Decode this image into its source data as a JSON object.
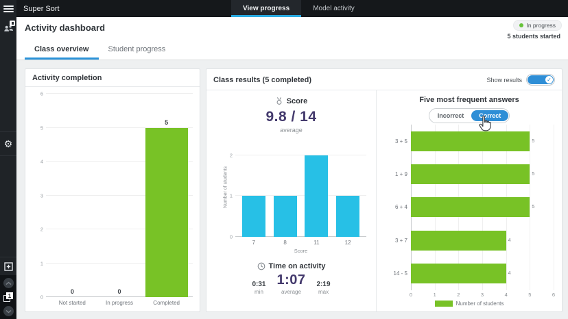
{
  "app": {
    "title": "Super Sort"
  },
  "topbar": {
    "tabs": [
      {
        "label": "View progress",
        "active": true
      },
      {
        "label": "Model activity",
        "active": false
      }
    ]
  },
  "header": {
    "title": "Activity dashboard",
    "status_badge": "In progress",
    "students_started": "5 students started"
  },
  "page_tabs": [
    {
      "label": "Class overview",
      "active": true
    },
    {
      "label": "Student progress",
      "active": false
    }
  ],
  "sidebar": {
    "page_indicator": "1"
  },
  "colors": {
    "green": "#78c226",
    "cyan": "#27c0e6",
    "blue": "#2e8ed6",
    "purple": "#443a6d",
    "status_green": "#67c23a",
    "tab_underline": "#29abe2"
  },
  "class_results": {
    "title": "Class results (5 completed)",
    "show_results_label": "Show results",
    "score": {
      "label": "Score",
      "value": "9.8 / 14",
      "caption": "average"
    },
    "time": {
      "label": "Time on activity",
      "min": {
        "value": "0:31",
        "caption": "min"
      },
      "average": {
        "value": "1:07",
        "caption": "average"
      },
      "max": {
        "value": "2:19",
        "caption": "max"
      }
    }
  },
  "frequent_answers": {
    "toggle": {
      "incorrect": "Incorrect",
      "correct": "Correct",
      "active": "correct"
    }
  },
  "chart_data": [
    {
      "id": "activity-completion",
      "type": "bar",
      "title": "Activity completion",
      "categories": [
        "Not started",
        "In progress",
        "Completed"
      ],
      "values": [
        0,
        0,
        5
      ],
      "ylim": [
        0,
        6
      ],
      "yticks": [
        0,
        1,
        2,
        3,
        4,
        5,
        6
      ],
      "bar_color": "#78c226",
      "value_labels": true,
      "grid": true,
      "legend_position": "none"
    },
    {
      "id": "score-distribution",
      "type": "bar",
      "title": "Score",
      "categories": [
        "7",
        "8",
        "11",
        "12"
      ],
      "values": [
        1,
        1,
        2,
        1
      ],
      "xlabel": "Score",
      "ylabel": "Number of students",
      "ylim": [
        0,
        2.4
      ],
      "yticks": [
        0,
        1,
        2
      ],
      "bar_color": "#27c0e6",
      "value_labels": false,
      "grid": true,
      "legend_position": "none"
    },
    {
      "id": "five-most-frequent-answers",
      "type": "bar-horizontal",
      "title": "Five most frequent answers",
      "categories": [
        "3 + 5",
        "1 + 9",
        "6 + 4",
        "3 + 7",
        "14 - 5"
      ],
      "values": [
        5,
        5,
        5,
        4,
        4
      ],
      "xlim": [
        0,
        6
      ],
      "xticks": [
        0,
        1,
        2,
        3,
        4,
        5,
        6
      ],
      "bar_color": "#78c226",
      "value_labels": true,
      "grid": true,
      "legend": "Number of students",
      "legend_position": "bottom"
    }
  ]
}
